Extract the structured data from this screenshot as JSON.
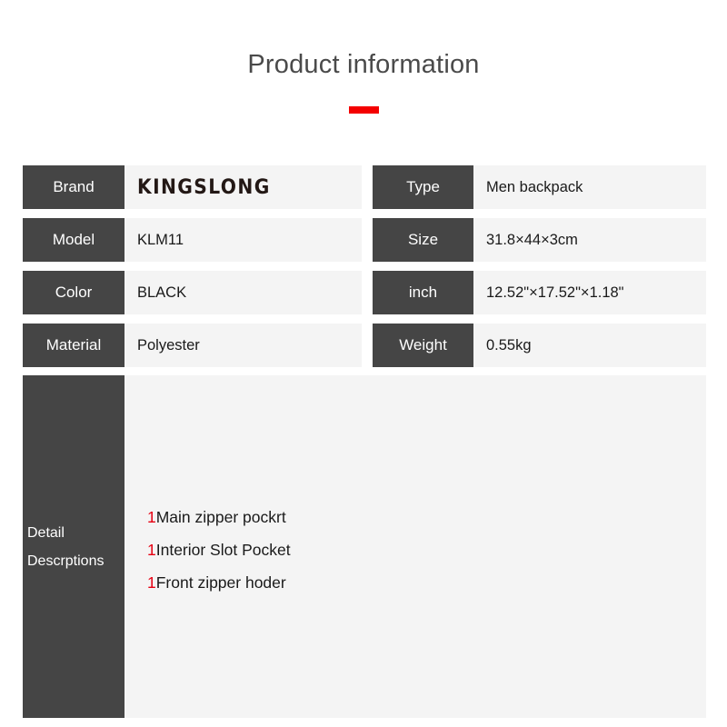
{
  "header": {
    "title": "Product information",
    "rule_color": "#f40000"
  },
  "theme": {
    "label_bg": "#454545",
    "value_bg": "#f4f4f4",
    "label_text": "#ffffff",
    "value_text": "#1a1a1a",
    "accent_red": "#e60012",
    "logo_color": "#231815"
  },
  "specs": {
    "rows": [
      {
        "left": {
          "label": "Brand",
          "value": "KINGSLONG"
        },
        "right": {
          "label": "Type",
          "value": "Men backpack"
        }
      },
      {
        "left": {
          "label": "Model",
          "value": "KLM11"
        },
        "right": {
          "label": "Size",
          "value": "31.8×44×3cm"
        }
      },
      {
        "left": {
          "label": "Color",
          "value": "BLACK"
        },
        "right": {
          "label": "inch",
          "value": "12.52\"×17.52\"×1.18\""
        }
      },
      {
        "left": {
          "label": "Material",
          "value": "Polyester"
        },
        "right": {
          "label": "Weight",
          "value": "0.55kg"
        }
      }
    ]
  },
  "detail": {
    "label_line1": "Detail",
    "label_line2": "Descrptions",
    "items": [
      {
        "qty": "1",
        "text": "Main zipper pockrt"
      },
      {
        "qty": "1",
        "text": "Interior Slot Pocket"
      },
      {
        "qty": "1",
        "text": "Front zipper hoder"
      }
    ]
  }
}
